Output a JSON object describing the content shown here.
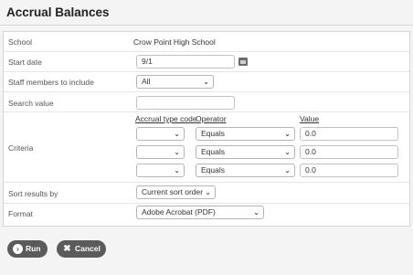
{
  "page": {
    "title": "Accrual Balances"
  },
  "form": {
    "school": {
      "label": "School",
      "value": "Crow Point High School"
    },
    "start_date": {
      "label": "Start date",
      "value": "9/1",
      "icon": "calendar-icon"
    },
    "staff": {
      "label": "Staff members to include",
      "selected": "All"
    },
    "search": {
      "label": "Search value",
      "value": ""
    },
    "criteria": {
      "label": "Criteria",
      "headers": {
        "type": "Accrual type code",
        "operator": "Operator",
        "value": "Value"
      },
      "rows": [
        {
          "type": "",
          "operator": "Equals",
          "value": "0.0"
        },
        {
          "type": "",
          "operator": "Equals",
          "value": "0.0"
        },
        {
          "type": "",
          "operator": "Equals",
          "value": "0.0"
        }
      ]
    },
    "sort": {
      "label": "Sort results by",
      "selected": "Current sort order"
    },
    "format": {
      "label": "Format",
      "selected": "Adobe Acrobat (PDF)"
    }
  },
  "actions": {
    "run_label": "Run",
    "cancel_label": "Cancel",
    "run_icon": "chevron-right-circle-icon",
    "cancel_icon": "close-icon"
  }
}
